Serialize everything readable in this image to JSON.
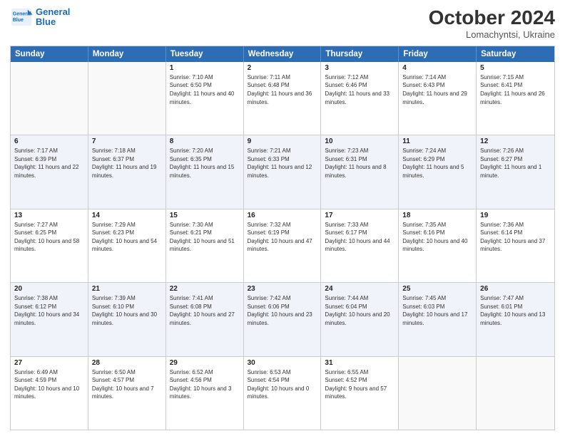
{
  "header": {
    "logo_line1": "General",
    "logo_line2": "Blue",
    "month_year": "October 2024",
    "location": "Lomachyntsi, Ukraine"
  },
  "days_of_week": [
    "Sunday",
    "Monday",
    "Tuesday",
    "Wednesday",
    "Thursday",
    "Friday",
    "Saturday"
  ],
  "weeks": [
    [
      {
        "day": "",
        "sunrise": "",
        "sunset": "",
        "daylight": ""
      },
      {
        "day": "",
        "sunrise": "",
        "sunset": "",
        "daylight": ""
      },
      {
        "day": "1",
        "sunrise": "Sunrise: 7:10 AM",
        "sunset": "Sunset: 6:50 PM",
        "daylight": "Daylight: 11 hours and 40 minutes."
      },
      {
        "day": "2",
        "sunrise": "Sunrise: 7:11 AM",
        "sunset": "Sunset: 6:48 PM",
        "daylight": "Daylight: 11 hours and 36 minutes."
      },
      {
        "day": "3",
        "sunrise": "Sunrise: 7:12 AM",
        "sunset": "Sunset: 6:46 PM",
        "daylight": "Daylight: 11 hours and 33 minutes."
      },
      {
        "day": "4",
        "sunrise": "Sunrise: 7:14 AM",
        "sunset": "Sunset: 6:43 PM",
        "daylight": "Daylight: 11 hours and 29 minutes."
      },
      {
        "day": "5",
        "sunrise": "Sunrise: 7:15 AM",
        "sunset": "Sunset: 6:41 PM",
        "daylight": "Daylight: 11 hours and 26 minutes."
      }
    ],
    [
      {
        "day": "6",
        "sunrise": "Sunrise: 7:17 AM",
        "sunset": "Sunset: 6:39 PM",
        "daylight": "Daylight: 11 hours and 22 minutes."
      },
      {
        "day": "7",
        "sunrise": "Sunrise: 7:18 AM",
        "sunset": "Sunset: 6:37 PM",
        "daylight": "Daylight: 11 hours and 19 minutes."
      },
      {
        "day": "8",
        "sunrise": "Sunrise: 7:20 AM",
        "sunset": "Sunset: 6:35 PM",
        "daylight": "Daylight: 11 hours and 15 minutes."
      },
      {
        "day": "9",
        "sunrise": "Sunrise: 7:21 AM",
        "sunset": "Sunset: 6:33 PM",
        "daylight": "Daylight: 11 hours and 12 minutes."
      },
      {
        "day": "10",
        "sunrise": "Sunrise: 7:23 AM",
        "sunset": "Sunset: 6:31 PM",
        "daylight": "Daylight: 11 hours and 8 minutes."
      },
      {
        "day": "11",
        "sunrise": "Sunrise: 7:24 AM",
        "sunset": "Sunset: 6:29 PM",
        "daylight": "Daylight: 11 hours and 5 minutes."
      },
      {
        "day": "12",
        "sunrise": "Sunrise: 7:26 AM",
        "sunset": "Sunset: 6:27 PM",
        "daylight": "Daylight: 11 hours and 1 minute."
      }
    ],
    [
      {
        "day": "13",
        "sunrise": "Sunrise: 7:27 AM",
        "sunset": "Sunset: 6:25 PM",
        "daylight": "Daylight: 10 hours and 58 minutes."
      },
      {
        "day": "14",
        "sunrise": "Sunrise: 7:29 AM",
        "sunset": "Sunset: 6:23 PM",
        "daylight": "Daylight: 10 hours and 54 minutes."
      },
      {
        "day": "15",
        "sunrise": "Sunrise: 7:30 AM",
        "sunset": "Sunset: 6:21 PM",
        "daylight": "Daylight: 10 hours and 51 minutes."
      },
      {
        "day": "16",
        "sunrise": "Sunrise: 7:32 AM",
        "sunset": "Sunset: 6:19 PM",
        "daylight": "Daylight: 10 hours and 47 minutes."
      },
      {
        "day": "17",
        "sunrise": "Sunrise: 7:33 AM",
        "sunset": "Sunset: 6:17 PM",
        "daylight": "Daylight: 10 hours and 44 minutes."
      },
      {
        "day": "18",
        "sunrise": "Sunrise: 7:35 AM",
        "sunset": "Sunset: 6:16 PM",
        "daylight": "Daylight: 10 hours and 40 minutes."
      },
      {
        "day": "19",
        "sunrise": "Sunrise: 7:36 AM",
        "sunset": "Sunset: 6:14 PM",
        "daylight": "Daylight: 10 hours and 37 minutes."
      }
    ],
    [
      {
        "day": "20",
        "sunrise": "Sunrise: 7:38 AM",
        "sunset": "Sunset: 6:12 PM",
        "daylight": "Daylight: 10 hours and 34 minutes."
      },
      {
        "day": "21",
        "sunrise": "Sunrise: 7:39 AM",
        "sunset": "Sunset: 6:10 PM",
        "daylight": "Daylight: 10 hours and 30 minutes."
      },
      {
        "day": "22",
        "sunrise": "Sunrise: 7:41 AM",
        "sunset": "Sunset: 6:08 PM",
        "daylight": "Daylight: 10 hours and 27 minutes."
      },
      {
        "day": "23",
        "sunrise": "Sunrise: 7:42 AM",
        "sunset": "Sunset: 6:06 PM",
        "daylight": "Daylight: 10 hours and 23 minutes."
      },
      {
        "day": "24",
        "sunrise": "Sunrise: 7:44 AM",
        "sunset": "Sunset: 6:04 PM",
        "daylight": "Daylight: 10 hours and 20 minutes."
      },
      {
        "day": "25",
        "sunrise": "Sunrise: 7:45 AM",
        "sunset": "Sunset: 6:03 PM",
        "daylight": "Daylight: 10 hours and 17 minutes."
      },
      {
        "day": "26",
        "sunrise": "Sunrise: 7:47 AM",
        "sunset": "Sunset: 6:01 PM",
        "daylight": "Daylight: 10 hours and 13 minutes."
      }
    ],
    [
      {
        "day": "27",
        "sunrise": "Sunrise: 6:49 AM",
        "sunset": "Sunset: 4:59 PM",
        "daylight": "Daylight: 10 hours and 10 minutes."
      },
      {
        "day": "28",
        "sunrise": "Sunrise: 6:50 AM",
        "sunset": "Sunset: 4:57 PM",
        "daylight": "Daylight: 10 hours and 7 minutes."
      },
      {
        "day": "29",
        "sunrise": "Sunrise: 6:52 AM",
        "sunset": "Sunset: 4:56 PM",
        "daylight": "Daylight: 10 hours and 3 minutes."
      },
      {
        "day": "30",
        "sunrise": "Sunrise: 6:53 AM",
        "sunset": "Sunset: 4:54 PM",
        "daylight": "Daylight: 10 hours and 0 minutes."
      },
      {
        "day": "31",
        "sunrise": "Sunrise: 6:55 AM",
        "sunset": "Sunset: 4:52 PM",
        "daylight": "Daylight: 9 hours and 57 minutes."
      },
      {
        "day": "",
        "sunrise": "",
        "sunset": "",
        "daylight": ""
      },
      {
        "day": "",
        "sunrise": "",
        "sunset": "",
        "daylight": ""
      }
    ]
  ]
}
